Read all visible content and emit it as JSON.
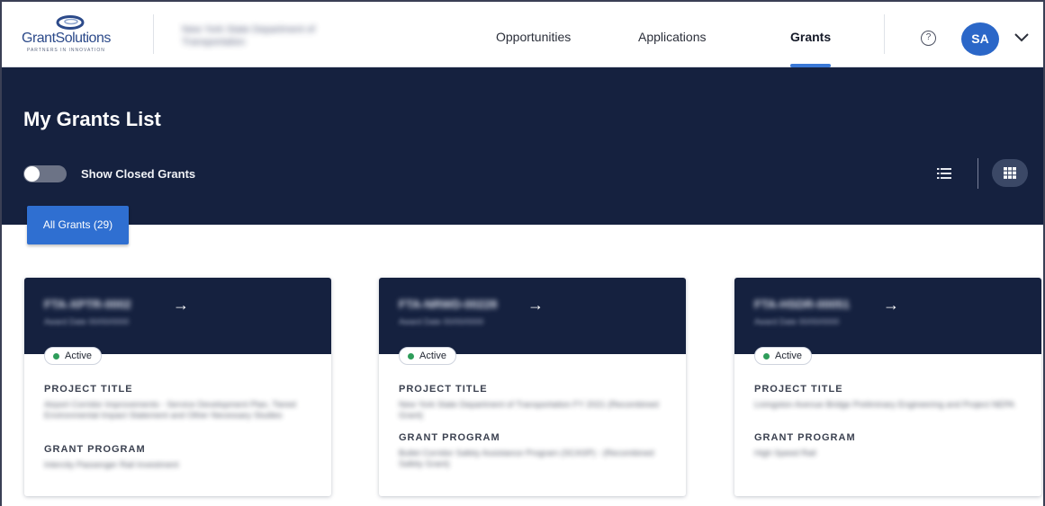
{
  "header": {
    "logo": {
      "text_part1": "Grant",
      "text_part2": "Solutions",
      "tagline": "PARTNERS IN INNOVATION"
    },
    "organization": "New York State Department of Transportation",
    "nav": [
      {
        "label": "Opportunities",
        "active": false
      },
      {
        "label": "Applications",
        "active": false
      },
      {
        "label": "Grants",
        "active": true
      }
    ],
    "help_icon": "question-circle-icon",
    "user_initials": "SA",
    "user_menu_icon": "chevron-down-icon",
    "accent_color": "#3a78d6"
  },
  "hero": {
    "title": "My Grants List",
    "toggle_label": "Show Closed Grants",
    "toggle_on": false,
    "view_options": [
      "list-view-icon",
      "grid-view-icon"
    ],
    "selected_view": "grid",
    "background_color": "#15213f"
  },
  "tabs": [
    {
      "label": "All Grants (29)",
      "active": true
    }
  ],
  "cards": [
    {
      "grant_number": "FTA-XPTR-0002",
      "grant_date": "Award Date 00/00/0000",
      "status": "Active",
      "project_title_label": "PROJECT TITLE",
      "project_title": "Airport Corridor Improvements - Service Development Plan, Tiered Environmental Impact Statement and Other Necessary Studies",
      "grant_program_label": "GRANT PROGRAM",
      "grant_program": "Intercity Passenger Rail Investment"
    },
    {
      "grant_number": "FTA-NRWD-00228",
      "grant_date": "Award Date 00/00/0000",
      "status": "Active",
      "project_title_label": "PROJECT TITLE",
      "project_title": "New York State Department of Transportation FY 2021 (Recombined Grant)",
      "grant_program_label": "GRANT PROGRAM",
      "grant_program": "Bullet Corridor Safety Assistance Program (SCASP) - (Recombined Safety Grant)"
    },
    {
      "grant_number": "FTA-HSDR-00051",
      "grant_date": "Award Date 00/00/0000",
      "status": "Active",
      "project_title_label": "PROJECT TITLE",
      "project_title": "Livingston Avenue Bridge Preliminary Engineering and Project NEPA",
      "grant_program_label": "GRANT PROGRAM",
      "grant_program": "High Speed Rail"
    }
  ],
  "status_color": "#2e9d5a"
}
